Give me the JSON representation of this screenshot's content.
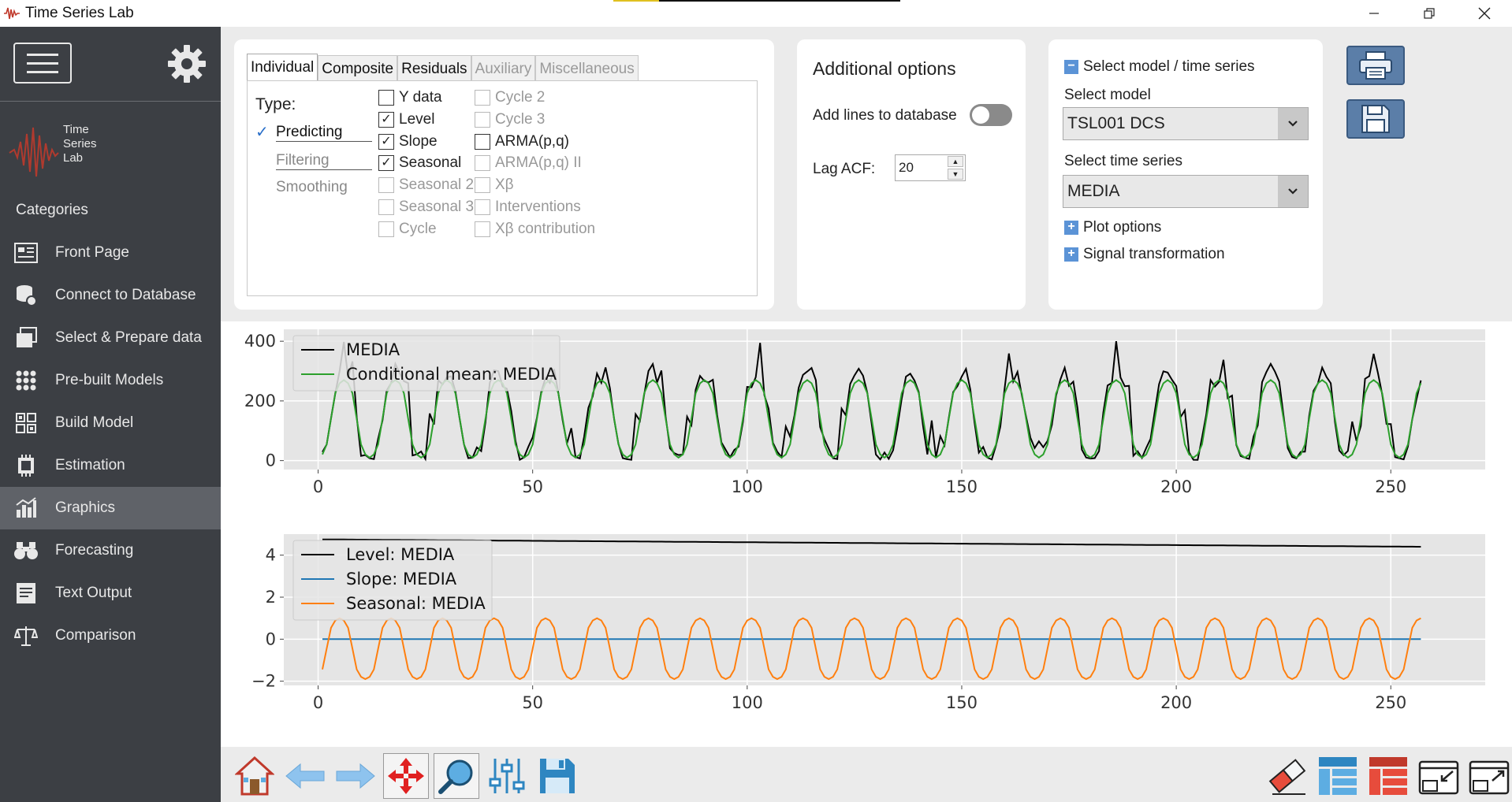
{
  "window": {
    "title": "Time Series Lab",
    "progress": 0.16
  },
  "sidebar": {
    "brand_line1": "Time",
    "brand_line2": "Series",
    "brand_line3": "Lab",
    "categories_label": "Categories",
    "items": [
      {
        "label": "Front Page",
        "icon": "front-page-icon",
        "active": false
      },
      {
        "label": "Connect to Database",
        "icon": "database-icon",
        "active": false
      },
      {
        "label": "Select & Prepare data",
        "icon": "prepare-data-icon",
        "active": false
      },
      {
        "label": "Pre-built Models",
        "icon": "prebuilt-models-icon",
        "active": false
      },
      {
        "label": "Build Model",
        "icon": "build-model-icon",
        "active": false
      },
      {
        "label": "Estimation",
        "icon": "estimation-icon",
        "active": false
      },
      {
        "label": "Graphics",
        "icon": "graphics-icon",
        "active": true
      },
      {
        "label": "Forecasting",
        "icon": "forecasting-icon",
        "active": false
      },
      {
        "label": "Text Output",
        "icon": "text-output-icon",
        "active": false
      },
      {
        "label": "Comparison",
        "icon": "comparison-icon",
        "active": false
      }
    ]
  },
  "tabs": {
    "items": [
      "Individual",
      "Composite",
      "Residuals",
      "Auxiliary",
      "Miscellaneous"
    ],
    "active": "Individual",
    "type_label": "Type:",
    "type_options": [
      "Predicting",
      "Filtering",
      "Smoothing"
    ],
    "selected_type": "Predicting",
    "checkboxes_col1": [
      {
        "label": "Y data",
        "checked": false,
        "enabled": true
      },
      {
        "label": "Level",
        "checked": true,
        "enabled": true
      },
      {
        "label": "Slope",
        "checked": true,
        "enabled": true
      },
      {
        "label": "Seasonal",
        "checked": true,
        "enabled": true
      },
      {
        "label": "Seasonal 2",
        "checked": false,
        "enabled": false
      },
      {
        "label": "Seasonal 3",
        "checked": false,
        "enabled": false
      },
      {
        "label": "Cycle",
        "checked": false,
        "enabled": false
      }
    ],
    "checkboxes_col2": [
      {
        "label": "Cycle 2",
        "checked": false,
        "enabled": false
      },
      {
        "label": "Cycle 3",
        "checked": false,
        "enabled": false
      },
      {
        "label": "ARMA(p,q)",
        "checked": false,
        "enabled": true
      },
      {
        "label": "ARMA(p,q) II",
        "checked": false,
        "enabled": false
      },
      {
        "label": "Xβ",
        "checked": false,
        "enabled": false
      },
      {
        "label": "Interventions",
        "checked": false,
        "enabled": false
      },
      {
        "label": "Xβ contribution",
        "checked": false,
        "enabled": false
      }
    ]
  },
  "additional_options": {
    "title": "Additional options",
    "add_lines_label": "Add lines to database",
    "add_lines_on": false,
    "lag_acf_label": "Lag ACF:",
    "lag_acf_value": "20"
  },
  "select_model": {
    "header": "Select model / time series",
    "model_label": "Select model",
    "model_value": "TSL001 DCS",
    "series_label": "Select time series",
    "series_value": "MEDIA",
    "plot_options": "Plot options",
    "signal_transformation": "Signal transformation"
  },
  "colors": {
    "sidebar_bg": "#3c3f44",
    "sidebar_active": "#5f6268",
    "plot_bg": "#e5e5e5",
    "series_black": "#000000",
    "series_green": "#2ca02c",
    "series_blue": "#1f77b4",
    "series_orange": "#ff7f0e"
  },
  "chart_data": [
    {
      "type": "line",
      "title": "",
      "xlabel": "",
      "ylabel": "",
      "xlim": [
        -8,
        272
      ],
      "ylim": [
        -30,
        440
      ],
      "xticks": [
        0,
        50,
        100,
        150,
        200,
        250
      ],
      "yticks": [
        0,
        200,
        400
      ],
      "grid": true,
      "legend": "top-left",
      "series": [
        {
          "name": "MEDIA",
          "color": "#000000",
          "x_start": 1,
          "x_end": 257,
          "period": 12,
          "amp": 145,
          "base": 145,
          "noise": true
        },
        {
          "name": "Conditional mean: MEDIA",
          "color": "#2ca02c",
          "x_start": 1,
          "x_end": 257,
          "period": 12,
          "amp": 130,
          "base": 140,
          "noise": false
        }
      ]
    },
    {
      "type": "line",
      "title": "",
      "xlabel": "",
      "ylabel": "",
      "xlim": [
        -8,
        272
      ],
      "ylim": [
        -2.2,
        5.0
      ],
      "xticks": [
        0,
        50,
        100,
        150,
        200,
        250
      ],
      "yticks": [
        -2,
        0,
        2,
        4
      ],
      "grid": true,
      "legend": "top-left",
      "series": [
        {
          "name": "Level: MEDIA",
          "color": "#000000",
          "x_start": 1,
          "x_end": 257,
          "start": 4.75,
          "end": 4.4
        },
        {
          "name": "Slope: MEDIA",
          "color": "#1f77b4",
          "x_start": 1,
          "x_end": 257,
          "value": 0.0
        },
        {
          "name": "Seasonal: MEDIA",
          "color": "#ff7f0e",
          "x_start": 1,
          "x_end": 257,
          "period": 12,
          "min": -1.9,
          "max": 1.0
        }
      ]
    }
  ],
  "bottom_toolbar": [
    "home-icon",
    "back-arrow-icon",
    "forward-arrow-icon",
    "pan-icon",
    "zoom-icon",
    "configure-subplots-icon",
    "save-figure-icon",
    "eraser-icon",
    "layout-blue-icon",
    "layout-red-icon",
    "window-shrink-icon",
    "window-expand-icon"
  ]
}
